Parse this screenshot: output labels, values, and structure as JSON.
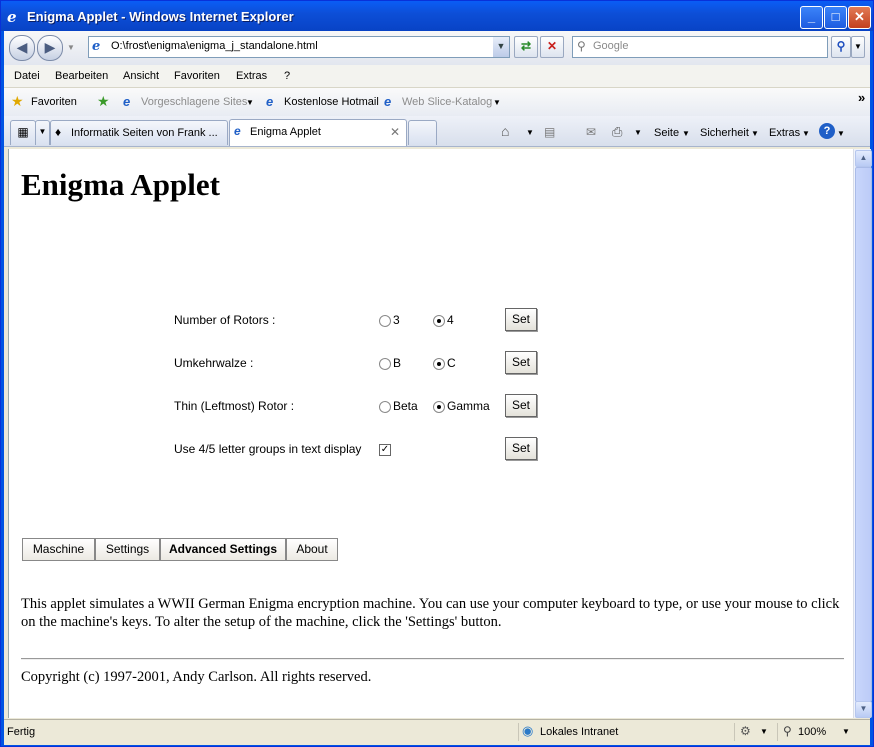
{
  "window": {
    "title": "Enigma Applet - Windows Internet Explorer",
    "minimize_glyph": "_",
    "maximize_glyph": "□",
    "close_glyph": "✕"
  },
  "address": {
    "url": "O:\\frost\\enigma\\enigma_j_standalone.html",
    "search_placeholder": "Google"
  },
  "menu": [
    "Datei",
    "Bearbeiten",
    "Ansicht",
    "Favoriten",
    "Extras",
    "?"
  ],
  "favorites": {
    "label": "Favoriten",
    "suggested": "Vorgeschlagene Sites",
    "hotmail": "Kostenlose Hotmail",
    "webslice": "Web Slice-Katalog"
  },
  "tabs": [
    {
      "label": "Informatik Seiten von Frank ..."
    },
    {
      "label": "Enigma Applet"
    }
  ],
  "commands": {
    "page": "Seite",
    "security": "Sicherheit",
    "extras": "Extras"
  },
  "page": {
    "title": "Enigma Applet",
    "settings": [
      {
        "label": "Number of Rotors :",
        "opt1": "3",
        "opt2": "4",
        "selected": 2,
        "button": "Set"
      },
      {
        "label": "Umkehrwalze :",
        "opt1": "B",
        "opt2": "C",
        "selected": 2,
        "button": "Set"
      },
      {
        "label": "Thin (Leftmost) Rotor :",
        "opt1": "Beta",
        "opt2": "Gamma",
        "selected": 2,
        "button": "Set"
      }
    ],
    "groups": {
      "label": "Use 4/5 letter groups in text display",
      "checked": true,
      "button": "Set"
    },
    "panel_tabs": [
      "Maschine",
      "Settings",
      "Advanced Settings",
      "About"
    ],
    "active_panel_tab": "Advanced Settings",
    "description": "This applet simulates a WWII German Enigma encryption machine. You can use your computer keyboard to type, or use your mouse to click on the machine's keys. To alter the setup of the machine, click the 'Settings' button.",
    "copyright": "Copyright (c) 1997-2001, Andy Carlson. All rights reserved."
  },
  "status": {
    "left": "Fertig",
    "zone": "Lokales Intranet",
    "zoom": "100%"
  }
}
